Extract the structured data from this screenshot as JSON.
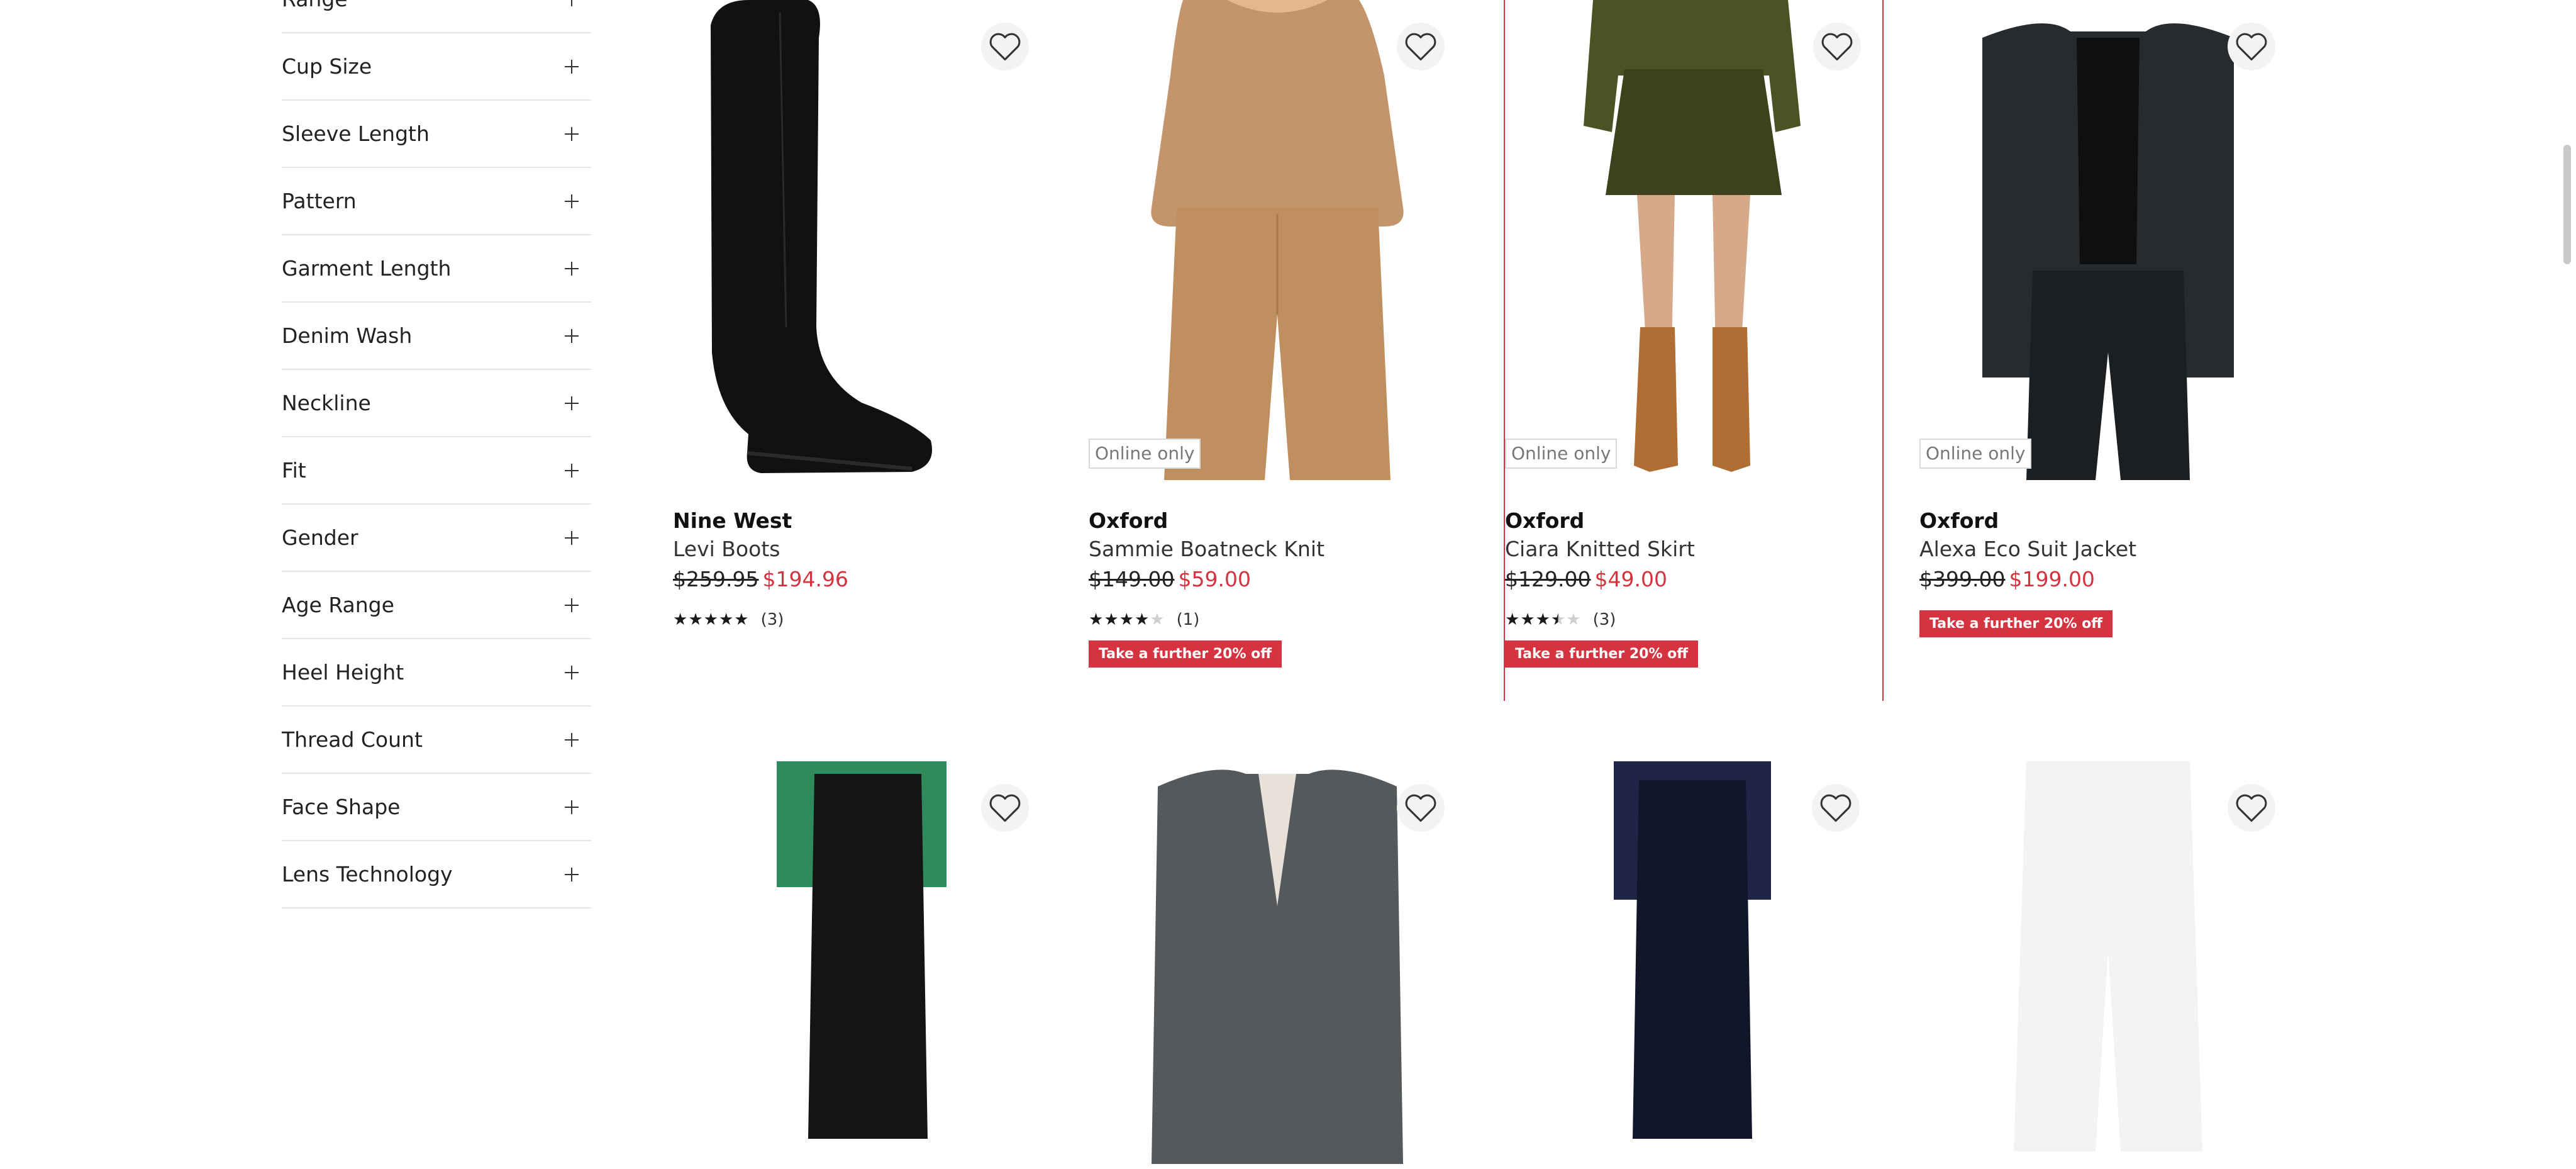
{
  "filters": [
    {
      "label": "Range"
    },
    {
      "label": "Cup Size"
    },
    {
      "label": "Sleeve Length"
    },
    {
      "label": "Pattern"
    },
    {
      "label": "Garment Length"
    },
    {
      "label": "Denim Wash"
    },
    {
      "label": "Neckline"
    },
    {
      "label": "Fit"
    },
    {
      "label": "Gender"
    },
    {
      "label": "Age Range"
    },
    {
      "label": "Heel Height"
    },
    {
      "label": "Thread Count"
    },
    {
      "label": "Face Shape"
    },
    {
      "label": "Lens Technology"
    }
  ],
  "products": [
    {
      "brand": "Nine West",
      "name": "Levi Boots",
      "was": "$259.95",
      "now": "$194.96",
      "rating": 5,
      "review_count": "(3)",
      "online_only": "",
      "promo": ""
    },
    {
      "brand": "Oxford",
      "name": "Sammie Boatneck Knit",
      "was": "$149.00",
      "now": "$59.00",
      "rating": 4,
      "review_count": "(1)",
      "online_only": "Online only",
      "promo": "Take a further 20% off"
    },
    {
      "brand": "Oxford",
      "name": "Ciara Knitted Skirt",
      "was": "$129.00",
      "now": "$49.00",
      "rating": 3.5,
      "review_count": "(3)",
      "online_only": "Online only",
      "promo": "Take a further 20% off"
    },
    {
      "brand": "Oxford",
      "name": "Alexa Eco Suit Jacket",
      "was": "$399.00",
      "now": "$199.00",
      "rating": null,
      "review_count": "",
      "online_only": "Online only",
      "promo": "Take a further 20% off"
    }
  ],
  "icons": {
    "filter_expand": "plus-icon",
    "wishlist": "heart-outline-icon",
    "rating": "star-icon"
  },
  "colors": {
    "sale_price": "#d4333f",
    "promo_badge": "#d4333f",
    "highlight_border": "#d4333f"
  }
}
